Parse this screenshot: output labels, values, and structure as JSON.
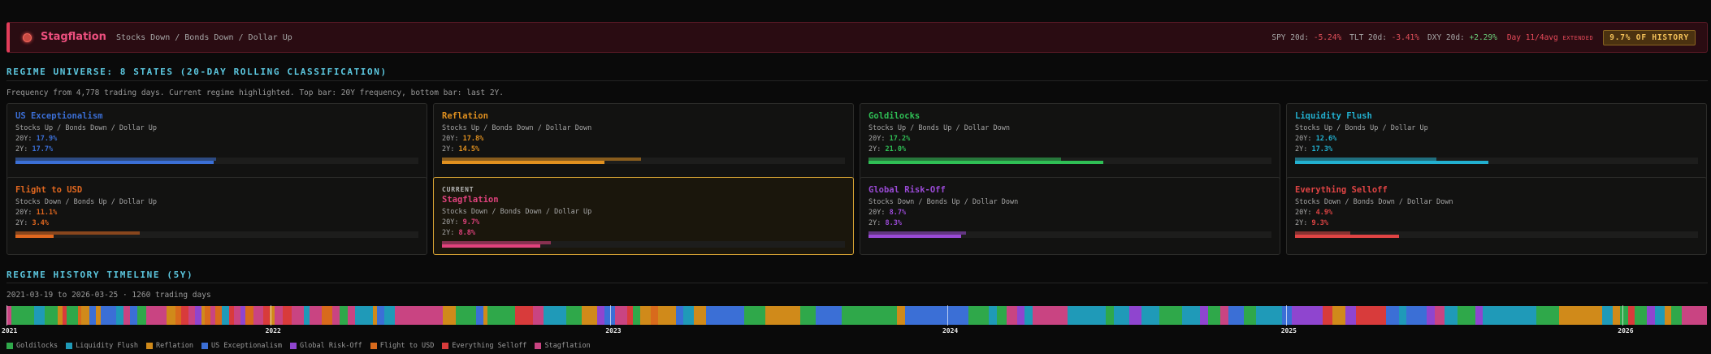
{
  "banner": {
    "regime": "Stagflation",
    "description": "Stocks Down / Bonds Down / Dollar Up",
    "spy_label": "SPY 20d:",
    "spy_value": "-5.24%",
    "tlt_label": "TLT 20d:",
    "tlt_value": "-3.41%",
    "dxy_label": "DXY 20d:",
    "dxy_value": "+2.29%",
    "day_text": "Day 11/4avg",
    "extended": "EXTENDED",
    "history_badge": "9.7% OF HISTORY"
  },
  "universe": {
    "title": "REGIME UNIVERSE: 8 STATES (20-DAY ROLLING CLASSIFICATION)",
    "subtitle": "Frequency from 4,778 trading days. Current regime highlighted. Top bar: 20Y frequency, bottom bar: last 2Y.",
    "current_label": "CURRENT",
    "cards": [
      {
        "name": "US Exceptionalism",
        "desc": "Stocks Up / Bonds Down / Dollar Up",
        "f20_label": "20Y:",
        "f20": "17.9%",
        "f2_label": "2Y:",
        "f2": "17.7%",
        "f20_value": 17.9,
        "f2_value": 17.7,
        "color": "#3b6fd6",
        "current": false
      },
      {
        "name": "Reflation",
        "desc": "Stocks Up / Bonds Down / Dollar Down",
        "f20_label": "20Y:",
        "f20": "17.8%",
        "f2_label": "2Y:",
        "f2": "14.5%",
        "f20_value": 17.8,
        "f2_value": 14.5,
        "color": "#e0901f",
        "current": false
      },
      {
        "name": "Goldilocks",
        "desc": "Stocks Up / Bonds Up / Dollar Down",
        "f20_label": "20Y:",
        "f20": "17.2%",
        "f2_label": "2Y:",
        "f2": "21.0%",
        "f20_value": 17.2,
        "f2_value": 21.0,
        "color": "#2fbf55",
        "current": false
      },
      {
        "name": "Liquidity Flush",
        "desc": "Stocks Up / Bonds Up / Dollar Up",
        "f20_label": "20Y:",
        "f20": "12.6%",
        "f2_label": "2Y:",
        "f2": "17.3%",
        "f20_value": 12.6,
        "f2_value": 17.3,
        "color": "#22b0d0",
        "current": false
      },
      {
        "name": "Flight to USD",
        "desc": "Stocks Down / Bonds Up / Dollar Up",
        "f20_label": "20Y:",
        "f20": "11.1%",
        "f2_label": "2Y:",
        "f2": "3.4%",
        "f20_value": 11.1,
        "f2_value": 3.4,
        "color": "#e0671f",
        "current": false
      },
      {
        "name": "Stagflation",
        "desc": "Stocks Down / Bonds Down / Dollar Up",
        "f20_label": "20Y:",
        "f20": "9.7%",
        "f2_label": "2Y:",
        "f2": "8.8%",
        "f20_value": 9.7,
        "f2_value": 8.8,
        "color": "#e0427d",
        "current": true
      },
      {
        "name": "Global Risk-Off",
        "desc": "Stocks Down / Bonds Up / Dollar Down",
        "f20_label": "20Y:",
        "f20": "8.7%",
        "f2_label": "2Y:",
        "f2": "8.3%",
        "f20_value": 8.7,
        "f2_value": 8.3,
        "color": "#9a4ad6",
        "current": false
      },
      {
        "name": "Everything Selloff",
        "desc": "Stocks Down / Bonds Down / Dollar Down",
        "f20_label": "20Y:",
        "f20": "4.9%",
        "f2_label": "2Y:",
        "f2": "9.3%",
        "f20_value": 4.9,
        "f2_value": 9.3,
        "color": "#e04444",
        "current": false
      }
    ]
  },
  "timeline": {
    "title": "REGIME HISTORY TIMELINE (5Y)",
    "range_text": "2021-03-19 to 2026-03-25 · 1260 trading days",
    "years": [
      {
        "label": "2021",
        "fraction": 0.0
      },
      {
        "label": "2022",
        "fraction": 0.155
      },
      {
        "label": "2023",
        "fraction": 0.355
      },
      {
        "label": "2024",
        "fraction": 0.553
      },
      {
        "label": "2025",
        "fraction": 0.752
      },
      {
        "label": "2026",
        "fraction": 0.95
      }
    ],
    "sequence": [
      {
        "r": "Stagflation",
        "w": 4
      },
      {
        "r": "Goldilocks",
        "w": 18
      },
      {
        "r": "Liquidity Flush",
        "w": 8
      },
      {
        "r": "Goldilocks",
        "w": 10
      },
      {
        "r": "Reflation",
        "w": 4
      },
      {
        "r": "Everything Selloff",
        "w": 3
      },
      {
        "r": "Goldilocks",
        "w": 9
      },
      {
        "r": "Flight to USD",
        "w": 3
      },
      {
        "r": "Reflation",
        "w": 6
      },
      {
        "r": "US Exceptionalism",
        "w": 5
      },
      {
        "r": "Reflation",
        "w": 4
      },
      {
        "r": "US Exceptionalism",
        "w": 12
      },
      {
        "r": "Liquidity Flush",
        "w": 6
      },
      {
        "r": "Stagflation",
        "w": 5
      },
      {
        "r": "US Exceptionalism",
        "w": 6
      },
      {
        "r": "Goldilocks",
        "w": 7
      },
      {
        "r": "Stagflation",
        "w": 16
      },
      {
        "r": "Reflation",
        "w": 7
      },
      {
        "r": "Flight to USD",
        "w": 4
      },
      {
        "r": "Everything Selloff",
        "w": 6
      },
      {
        "r": "Stagflation",
        "w": 5
      },
      {
        "r": "Global Risk-Off",
        "w": 5
      },
      {
        "r": "Reflation",
        "w": 3
      },
      {
        "r": "Flight to USD",
        "w": 4
      },
      {
        "r": "Stagflation",
        "w": 4
      },
      {
        "r": "Flight to USD",
        "w": 5
      },
      {
        "r": "Liquidity Flush",
        "w": 6
      },
      {
        "r": "Everything Selloff",
        "w": 4
      },
      {
        "r": "Stagflation",
        "w": 5
      },
      {
        "r": "Global Risk-Off",
        "w": 4
      },
      {
        "r": "Flight to USD",
        "w": 6
      },
      {
        "r": "Stagflation",
        "w": 8
      },
      {
        "r": "Everything Selloff",
        "w": 5
      },
      {
        "r": "Reflation",
        "w": 4
      },
      {
        "r": "Stagflation",
        "w": 6
      },
      {
        "r": "Everything Selloff",
        "w": 7
      },
      {
        "r": "Stagflation",
        "w": 10
      },
      {
        "r": "Liquidity Flush",
        "w": 4
      },
      {
        "r": "Stagflation",
        "w": 10
      },
      {
        "r": "Flight to USD",
        "w": 8
      },
      {
        "r": "Stagflation",
        "w": 6
      },
      {
        "r": "Goldilocks",
        "w": 6
      },
      {
        "r": "Stagflation",
        "w": 6
      },
      {
        "r": "Liquidity Flush",
        "w": 14
      },
      {
        "r": "Reflation",
        "w": 3
      },
      {
        "r": "US Exceptionalism",
        "w": 6
      },
      {
        "r": "Liquidity Flush",
        "w": 8
      },
      {
        "r": "Stagflation",
        "w": 38
      },
      {
        "r": "Reflation",
        "w": 10
      },
      {
        "r": "Goldilocks",
        "w": 16
      },
      {
        "r": "US Exceptionalism",
        "w": 6
      },
      {
        "r": "Reflation",
        "w": 3
      },
      {
        "r": "Goldilocks",
        "w": 22
      },
      {
        "r": "Everything Selloff",
        "w": 14
      },
      {
        "r": "Stagflation",
        "w": 8
      },
      {
        "r": "Liquidity Flush",
        "w": 18
      },
      {
        "r": "Goldilocks",
        "w": 12
      },
      {
        "r": "Reflation",
        "w": 12
      },
      {
        "r": "Global Risk-Off",
        "w": 6
      },
      {
        "r": "US Exceptionalism",
        "w": 8
      },
      {
        "r": "Stagflation",
        "w": 10
      },
      {
        "r": "Everything Selloff",
        "w": 4
      },
      {
        "r": "Goldilocks",
        "w": 6
      },
      {
        "r": "Reflation",
        "w": 8
      },
      {
        "r": "Flight to USD",
        "w": 6
      },
      {
        "r": "Reflation",
        "w": 14
      },
      {
        "r": "US Exceptionalism",
        "w": 6
      },
      {
        "r": "Liquidity Flush",
        "w": 8
      },
      {
        "r": "Reflation",
        "w": 10
      },
      {
        "r": "US Exceptionalism",
        "w": 30
      },
      {
        "r": "Goldilocks",
        "w": 16
      },
      {
        "r": "Reflation",
        "w": 28
      },
      {
        "r": "Goldilocks",
        "w": 12
      },
      {
        "r": "US Exceptionalism",
        "w": 20
      },
      {
        "r": "Goldilocks",
        "w": 44
      },
      {
        "r": "Reflation",
        "w": 6
      },
      {
        "r": "US Exceptionalism",
        "w": 50
      },
      {
        "r": "Goldilocks",
        "w": 16
      },
      {
        "r": "Liquidity Flush",
        "w": 6
      },
      {
        "r": "Goldilocks",
        "w": 8
      },
      {
        "r": "Stagflation",
        "w": 8
      },
      {
        "r": "Global Risk-Off",
        "w": 6
      },
      {
        "r": "Liquidity Flush",
        "w": 6
      },
      {
        "r": "Stagflation",
        "w": 28
      },
      {
        "r": "Liquidity Flush",
        "w": 30
      },
      {
        "r": "Goldilocks",
        "w": 6
      },
      {
        "r": "Liquidity Flush",
        "w": 12
      },
      {
        "r": "Global Risk-Off",
        "w": 10
      },
      {
        "r": "Liquidity Flush",
        "w": 14
      },
      {
        "r": "Goldilocks",
        "w": 18
      },
      {
        "r": "Liquidity Flush",
        "w": 14
      },
      {
        "r": "Global Risk-Off",
        "w": 6
      },
      {
        "r": "Goldilocks",
        "w": 10
      },
      {
        "r": "Stagflation",
        "w": 6
      },
      {
        "r": "US Exceptionalism",
        "w": 12
      },
      {
        "r": "Goldilocks",
        "w": 10
      },
      {
        "r": "Liquidity Flush",
        "w": 20
      },
      {
        "r": "US Exceptionalism",
        "w": 8
      },
      {
        "r": "Global Risk-Off",
        "w": 24
      },
      {
        "r": "Everything Selloff",
        "w": 8
      },
      {
        "r": "Reflation",
        "w": 10
      },
      {
        "r": "Global Risk-Off",
        "w": 8
      },
      {
        "r": "Everything Selloff",
        "w": 24
      },
      {
        "r": "US Exceptionalism",
        "w": 10
      },
      {
        "r": "Liquidity Flush",
        "w": 6
      },
      {
        "r": "US Exceptionalism",
        "w": 16
      },
      {
        "r": "Global Risk-Off",
        "w": 6
      },
      {
        "r": "Stagflation",
        "w": 8
      },
      {
        "r": "Liquidity Flush",
        "w": 10
      },
      {
        "r": "Goldilocks",
        "w": 14
      },
      {
        "r": "Global Risk-Off",
        "w": 6
      },
      {
        "r": "Liquidity Flush",
        "w": 42
      },
      {
        "r": "Goldilocks",
        "w": 18
      },
      {
        "r": "Reflation",
        "w": 34
      },
      {
        "r": "Liquidity Flush",
        "w": 8
      },
      {
        "r": "Reflation",
        "w": 6
      },
      {
        "r": "Goldilocks",
        "w": 6
      },
      {
        "r": "Everything Selloff",
        "w": 5
      },
      {
        "r": "Goldilocks",
        "w": 10
      },
      {
        "r": "Global Risk-Off",
        "w": 6
      },
      {
        "r": "Liquidity Flush",
        "w": 8
      },
      {
        "r": "Reflation",
        "w": 5
      },
      {
        "r": "Goldilocks",
        "w": 8
      },
      {
        "r": "Stagflation",
        "w": 20
      }
    ]
  },
  "legend": [
    {
      "label": "Goldilocks",
      "color": "#2fa84a"
    },
    {
      "label": "Liquidity Flush",
      "color": "#1f9ab8"
    },
    {
      "label": "Reflation",
      "color": "#d08a1a"
    },
    {
      "label": "US Exceptionalism",
      "color": "#3b6fd6"
    },
    {
      "label": "Global Risk-Off",
      "color": "#8f45cf"
    },
    {
      "label": "Flight to USD",
      "color": "#d86a1c"
    },
    {
      "label": "Everything Selloff",
      "color": "#d83b3b"
    },
    {
      "label": "Stagflation",
      "color": "#c94482"
    }
  ]
}
